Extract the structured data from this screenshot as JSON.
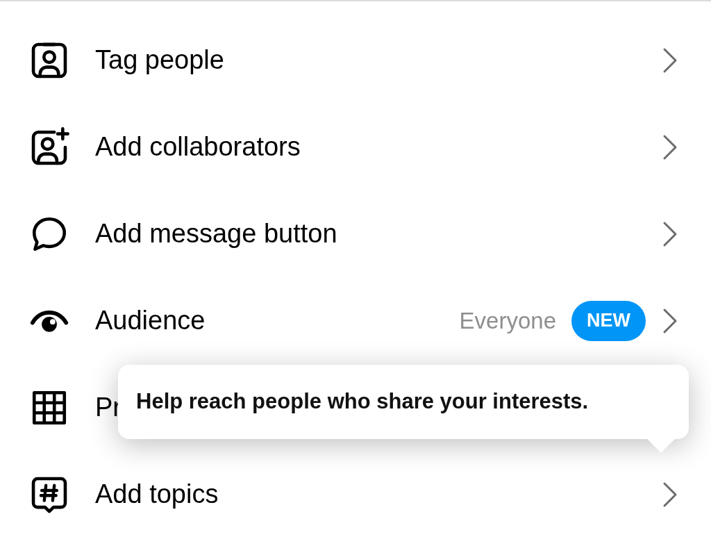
{
  "rows": [
    {
      "kind": "tag",
      "label": "Tag people",
      "has_chevron": true
    },
    {
      "kind": "collab",
      "label": "Add collaborators",
      "has_chevron": true
    },
    {
      "kind": "message",
      "label": "Add message button",
      "has_chevron": true
    },
    {
      "kind": "audience",
      "label": "Audience",
      "value": "Everyone",
      "badge": "NEW",
      "has_chevron": true
    },
    {
      "kind": "grid",
      "label": "Pr",
      "has_chevron": false
    },
    {
      "kind": "topics",
      "label": "Add topics",
      "has_chevron": true
    }
  ],
  "tooltip": {
    "text": "Help reach people who share your interests."
  }
}
